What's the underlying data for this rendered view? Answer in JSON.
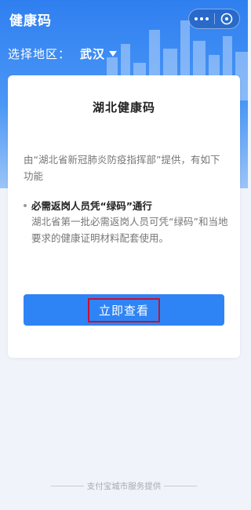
{
  "header": {
    "title": "健康码",
    "more_icon": "more-dots-icon",
    "close_icon": "circle-close-icon"
  },
  "region": {
    "label": "选择地区：",
    "city": "武汉"
  },
  "card": {
    "title": "湖北健康码",
    "intro": "由“湖北省新冠肺炎防疫指挥部”提供，有如下功能",
    "feature_title": "必需返岗人员凭“绿码”通行",
    "feature_desc": "湖北省第一批必需返岗人员可凭“绿码”和当地要求的健康证明材料配套使用。",
    "button_label": "立即查看"
  },
  "footer": {
    "text": "支付宝城市服务提供"
  },
  "colors": {
    "header_blue": "#2f7ff0",
    "button_blue": "#2f84f5",
    "highlight_red": "#c8102e"
  }
}
